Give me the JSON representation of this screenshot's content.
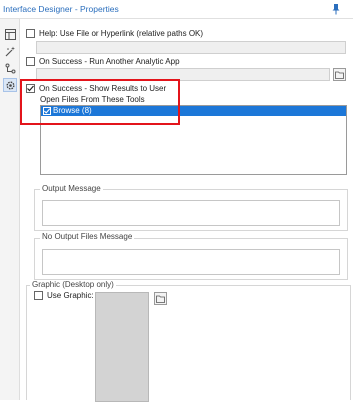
{
  "window": {
    "title": "Interface Designer - Properties"
  },
  "sidebar": {
    "items": [
      {
        "icon": "layout-icon"
      },
      {
        "icon": "wand-icon"
      },
      {
        "icon": "tree-icon"
      },
      {
        "icon": "gear-icon"
      }
    ]
  },
  "help": {
    "label": "Help: Use File or Hyperlink (relative paths OK)",
    "checked": false,
    "value": ""
  },
  "run_app": {
    "label": "On Success - Run Another Analytic App",
    "checked": false,
    "value": ""
  },
  "show_results": {
    "label": "On Success - Show Results to User",
    "checked": true,
    "list_title": "Open Files From These Tools",
    "items": [
      {
        "label": "Browse (8)",
        "checked": true
      }
    ]
  },
  "output_message": {
    "label": "Output Message",
    "value": ""
  },
  "no_output_message": {
    "label": "No Output Files Message",
    "value": ""
  },
  "graphic": {
    "label": "Graphic (Desktop only)",
    "use_label": "Use Graphic:",
    "checked": false
  },
  "colors": {
    "accent": "#2a6ebd",
    "selection": "#1c77d8",
    "highlight_border": "#e3141b"
  }
}
